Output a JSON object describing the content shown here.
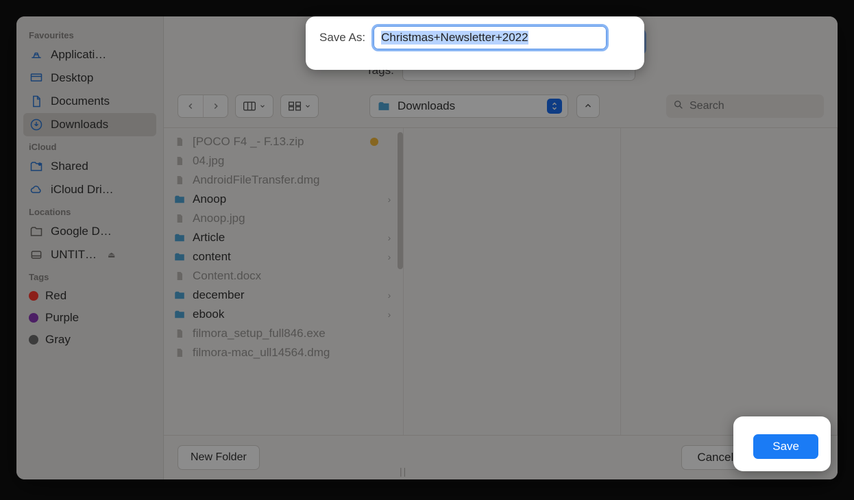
{
  "save_as": {
    "label": "Save As:",
    "value": "Christmas+Newsletter+2022"
  },
  "tags": {
    "label": "Tags:"
  },
  "location": {
    "label": "Downloads"
  },
  "search": {
    "placeholder": "Search"
  },
  "sidebar": {
    "sections": {
      "favourites": "Favourites",
      "icloud": "iCloud",
      "locations": "Locations",
      "tags": "Tags"
    },
    "favourites": [
      {
        "label": "Applicati…",
        "icon": "apps"
      },
      {
        "label": "Desktop",
        "icon": "desktop"
      },
      {
        "label": "Documents",
        "icon": "doc"
      },
      {
        "label": "Downloads",
        "icon": "download",
        "selected": true
      }
    ],
    "icloud": [
      {
        "label": "Shared",
        "icon": "shared"
      },
      {
        "label": "iCloud Dri…",
        "icon": "cloud"
      }
    ],
    "locations": [
      {
        "label": "Google D…",
        "icon": "folder"
      },
      {
        "label": "UNTIT…",
        "icon": "disk",
        "ejectable": true
      }
    ],
    "tags": [
      {
        "label": "Red",
        "color": "#ff3b30"
      },
      {
        "label": "Purple",
        "color": "#8a3ab9"
      },
      {
        "label": "Gray",
        "color": "#6e6e6e"
      }
    ]
  },
  "files": [
    {
      "label": "[POCO F4 _- F.13.zip",
      "type": "file",
      "dimmed": true,
      "tagged": "#f5ba3c"
    },
    {
      "label": "04.jpg",
      "type": "file",
      "dimmed": true
    },
    {
      "label": "AndroidFileTransfer.dmg",
      "type": "file",
      "dimmed": true
    },
    {
      "label": "Anoop",
      "type": "folder"
    },
    {
      "label": "Anoop.jpg",
      "type": "file",
      "dimmed": true
    },
    {
      "label": "Article",
      "type": "folder"
    },
    {
      "label": "content",
      "type": "folder"
    },
    {
      "label": "Content.docx",
      "type": "file",
      "dimmed": true
    },
    {
      "label": "december",
      "type": "folder"
    },
    {
      "label": "ebook",
      "type": "folder"
    },
    {
      "label": "filmora_setup_full846.exe",
      "type": "file",
      "dimmed": true
    },
    {
      "label": "filmora-mac_ull14564.dmg",
      "type": "file",
      "dimmed": true
    }
  ],
  "footer": {
    "new_folder": "New Folder",
    "cancel": "Cancel",
    "save": "Save"
  },
  "colors": {
    "accent": "#1a7bf5",
    "folder": "#4fa6d8"
  }
}
